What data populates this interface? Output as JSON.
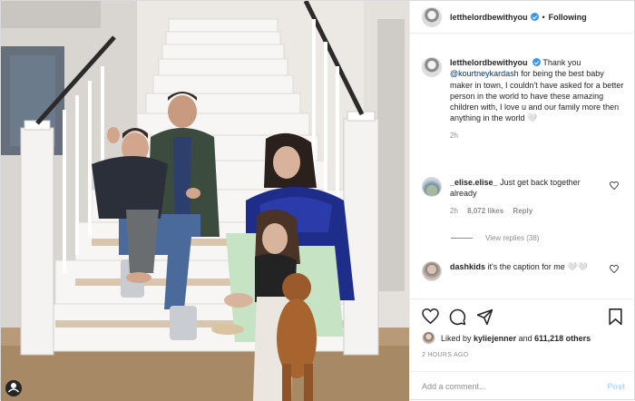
{
  "header": {
    "username": "letthelordbewithyou",
    "separator": "•",
    "follow_status": "Following"
  },
  "caption": {
    "username": "letthelordbewithyou",
    "text_before": "Thank you ",
    "mention": "@kourtneykardash",
    "text_after": " for being the best baby maker in town, I couldn't have asked for a better person in the world to have these amazing children with, I love u and our family more then anything in the world 🤍",
    "time": "2h"
  },
  "comments": [
    {
      "username": "_elise.elise_",
      "text": "Just get back together already",
      "time": "2h",
      "likes": "8,072 likes",
      "reply_label": "Reply",
      "view_replies": "View replies (38)"
    },
    {
      "username": "dashkids",
      "text": "it's the caption for me 🤍🤍"
    }
  ],
  "likes_bar": {
    "prefix": "Liked by ",
    "liker": "kyliejenner",
    "middle": " and ",
    "count": "611,218 others"
  },
  "timestamp": "2 HOURS AGO",
  "add_comment": {
    "placeholder": "Add a comment...",
    "post_label": "Post"
  },
  "icons": {
    "like": "heart-icon",
    "comment": "comment-icon",
    "share": "share-icon",
    "save": "bookmark-icon"
  },
  "colors": {
    "verified": "#3897f0",
    "mention": "#00376b",
    "secondary_text": "#8e8e8e",
    "post_button_disabled": "#b3dbff"
  }
}
